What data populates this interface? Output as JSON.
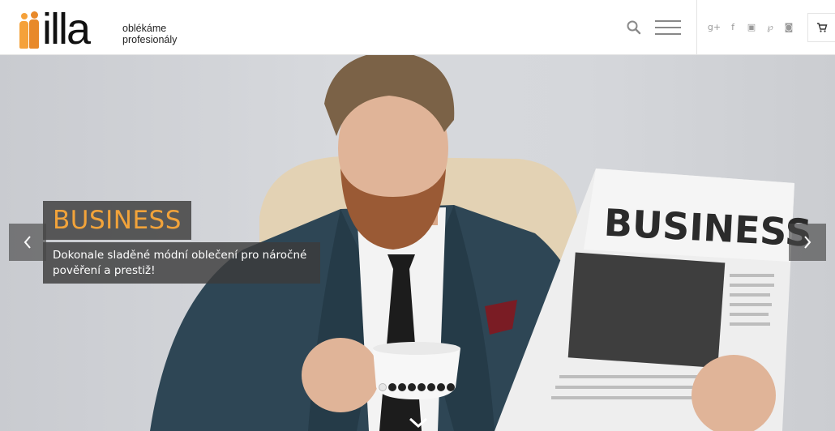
{
  "header": {
    "logo_text": "illa",
    "tagline_line1": "oblékáme",
    "tagline_line2": "profesionály",
    "search_icon": "search-icon",
    "menu_icon": "hamburger-menu-icon",
    "socials": [
      {
        "name": "google-plus-icon",
        "glyph": "g+"
      },
      {
        "name": "facebook-icon",
        "glyph": "f"
      },
      {
        "name": "youtube-icon",
        "glyph": "▣"
      },
      {
        "name": "pinterest-icon",
        "glyph": "℘"
      },
      {
        "name": "instagram-icon",
        "glyph": "◙"
      }
    ],
    "cart_icon": "cart-icon"
  },
  "slider": {
    "title": "BUSINESS",
    "description": "Dokonale sladěné módní oblečení pro náročné pověření a prestiž!",
    "newspaper_headline": "BUSINESS",
    "slide_count": 8,
    "active_slide": 1
  },
  "colors": {
    "accent": "#f2a33a",
    "overlay": "#464646"
  }
}
